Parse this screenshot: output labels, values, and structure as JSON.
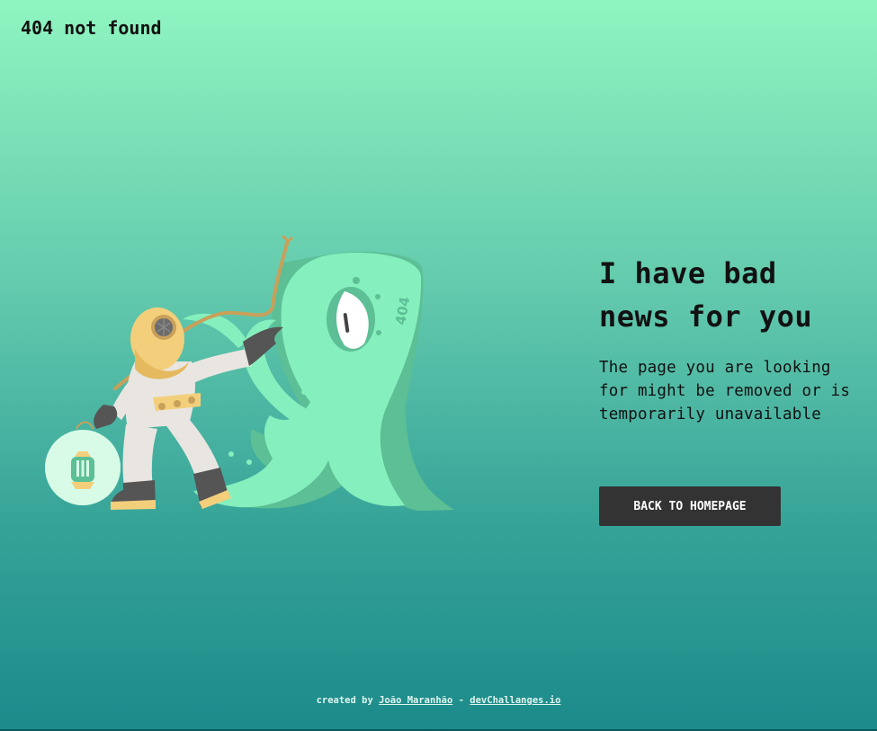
{
  "header": {
    "brand": "404 not found"
  },
  "main": {
    "headline_line1": "I have bad",
    "headline_line2": "news for you",
    "message": "The page you are looking for might be removed or is temporarily unavailable",
    "cta_label": "BACK TO HOMEPAGE"
  },
  "illustration": {
    "badge_text": "404",
    "icon": "diver-and-sea-monster-illustration"
  },
  "footer": {
    "prefix": "created by",
    "author": "João Maranhão",
    "separator": "-",
    "site": "devChallanges.io"
  },
  "colors": {
    "gradient_top": "#8ff5c0",
    "gradient_bottom": "#1b8a8a",
    "button_bg": "#333333",
    "monster": "#86efbe",
    "monster_shadow": "#5cbf95",
    "diver_helmet": "#f3cf7c",
    "diver_suit": "#e9e6e1"
  }
}
